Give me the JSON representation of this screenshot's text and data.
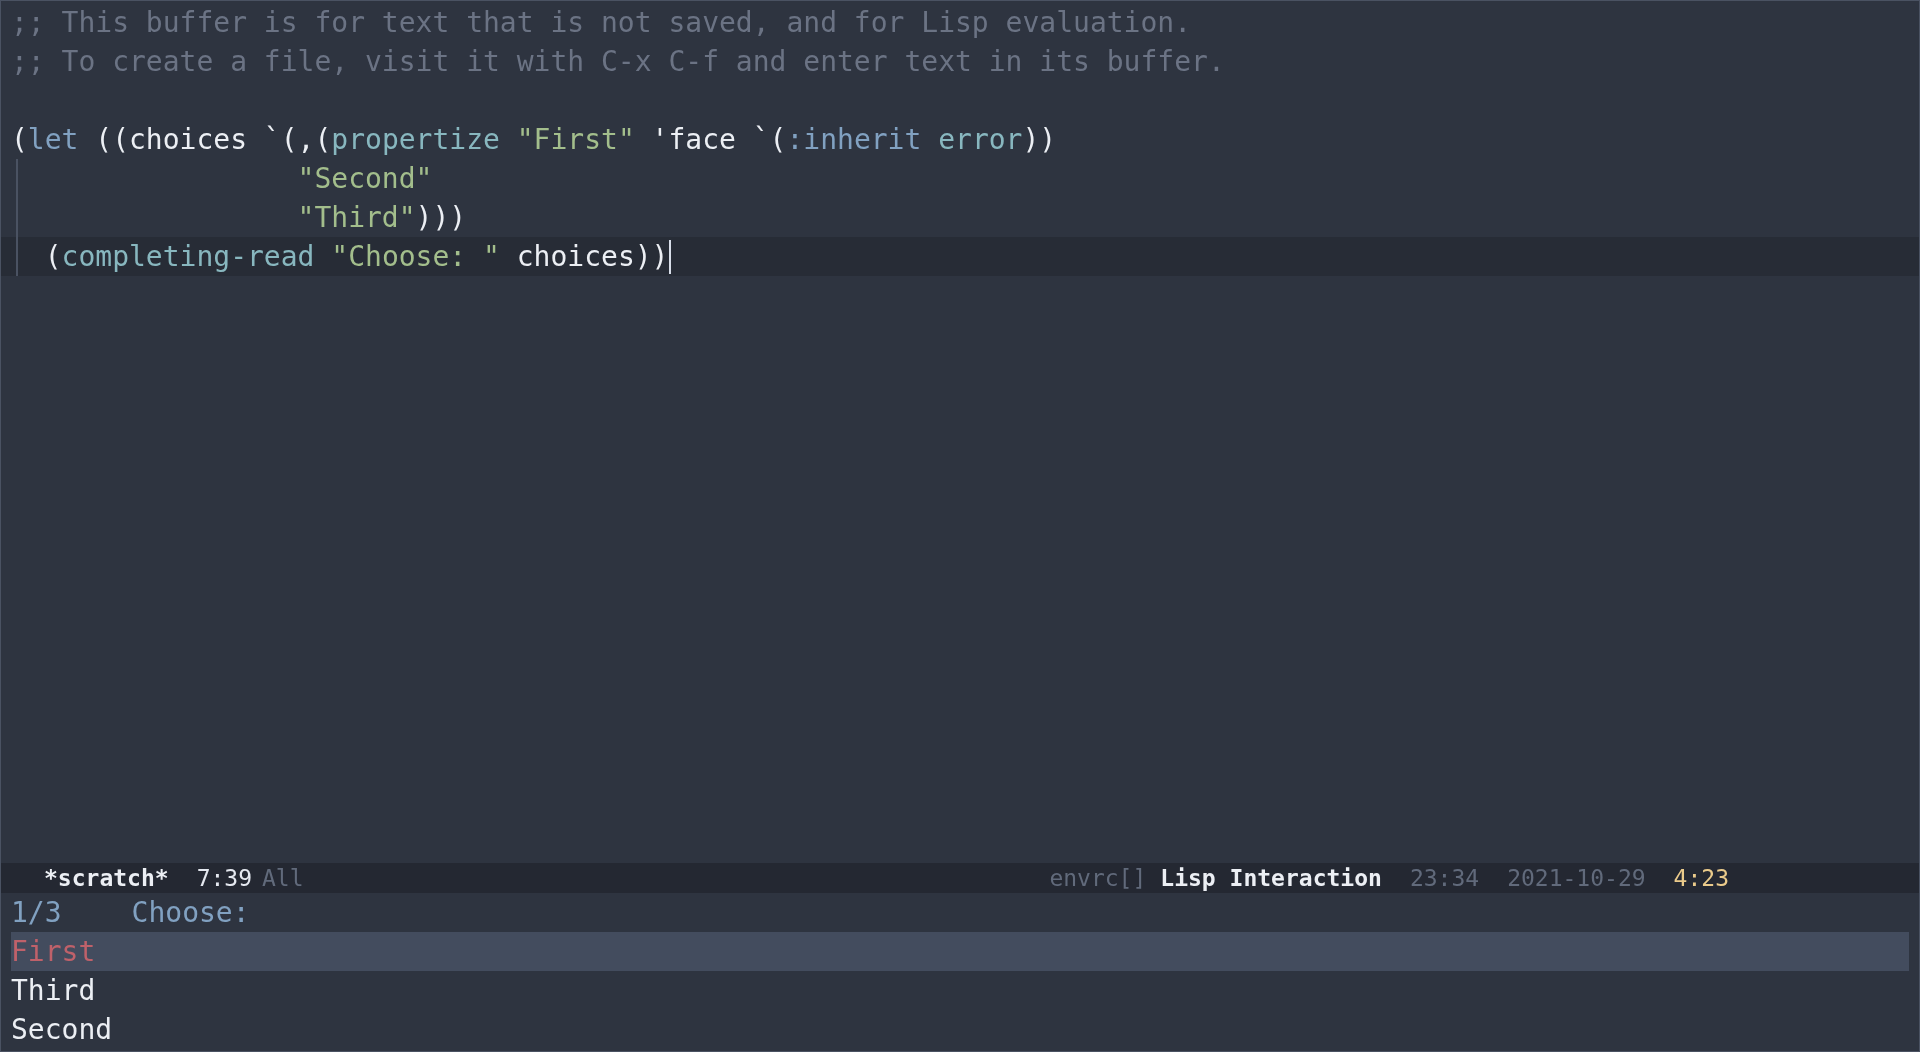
{
  "comments": [
    ";; This buffer is for text that is not saved, and for Lisp evaluation.",
    ";; To create a file, visit it with C-x C-f and enter text in its buffer."
  ],
  "code_lines": [
    {
      "indent_guide": false,
      "cursor": false,
      "tokens": [
        {
          "kind": "plain",
          "text": "("
        },
        {
          "kind": "keyword",
          "text": "let"
        },
        {
          "kind": "plain",
          "text": " ((choices `(,("
        },
        {
          "kind": "builtin",
          "text": "propertize"
        },
        {
          "kind": "string",
          "text": " \"First\""
        },
        {
          "kind": "plain",
          "text": " 'face `("
        },
        {
          "kind": "keyword",
          "text": ":inherit"
        },
        {
          "kind": "builtin",
          "text": " error"
        },
        {
          "kind": "plain",
          "text": "))"
        }
      ]
    },
    {
      "indent_guide": true,
      "cursor": false,
      "tokens": [
        {
          "kind": "string",
          "text": "                 \"Second\""
        }
      ]
    },
    {
      "indent_guide": true,
      "cursor": false,
      "tokens": [
        {
          "kind": "string",
          "text": "                 \"Third\""
        },
        {
          "kind": "plain",
          "text": ")))"
        }
      ]
    },
    {
      "indent_guide": true,
      "cursor": true,
      "tokens": [
        {
          "kind": "plain",
          "text": "  ("
        },
        {
          "kind": "builtin",
          "text": "completing-read"
        },
        {
          "kind": "string",
          "text": " \"Choose: \""
        },
        {
          "kind": "plain",
          "text": " choices))"
        }
      ]
    }
  ],
  "mode_line": {
    "buffer": "*scratch*",
    "position": "7:39",
    "scroll": "All",
    "minor_mode": "envrc[]",
    "major_mode": "Lisp Interaction",
    "clock": "23:34",
    "date": "2021-10-29",
    "battery_time": "4:23"
  },
  "minibuffer": {
    "count": "1/3",
    "prompt": "Choose:",
    "candidates": [
      {
        "text": "First",
        "kind": "error",
        "selected": true
      },
      {
        "text": "Third",
        "kind": "default",
        "selected": false
      },
      {
        "text": "Second",
        "kind": "default",
        "selected": false
      }
    ]
  }
}
